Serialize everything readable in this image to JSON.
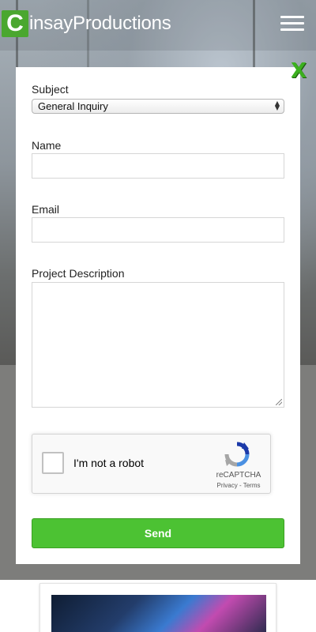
{
  "header": {
    "logo_mark": "C",
    "logo_text": "insayProductions"
  },
  "modal": {
    "close_label": "X",
    "subject": {
      "label": "Subject",
      "selected": "General Inquiry"
    },
    "name": {
      "label": "Name",
      "value": ""
    },
    "email": {
      "label": "Email",
      "value": ""
    },
    "description": {
      "label": "Project Description",
      "value": ""
    },
    "recaptcha": {
      "label": "I'm not a robot",
      "brand": "reCAPTCHA",
      "links": "Privacy - Terms",
      "checked": false
    },
    "send_label": "Send"
  },
  "colors": {
    "brand_green": "#4aa72f",
    "send_green": "#4cc233",
    "close_green": "#3cb01f"
  }
}
